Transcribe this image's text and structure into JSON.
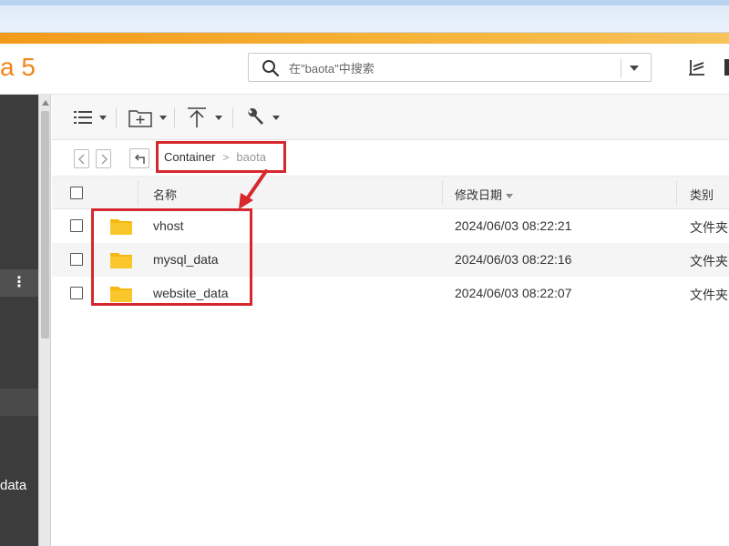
{
  "app": {
    "logo_text": "a 5"
  },
  "colors": {
    "accent_orange": "#f0861b",
    "annotation_red": "#d7272e",
    "folder_yellow": "#f6b70f"
  },
  "search": {
    "placeholder": "在\"baota\"中搜索",
    "value": ""
  },
  "header_icons": [
    "stack-icon",
    "window-icon"
  ],
  "sidebar": {
    "visible_label": "data",
    "menu_icon": "⋮"
  },
  "toolbar": {
    "buttons": [
      {
        "icon": "list-view-icon"
      },
      {
        "icon": "new-folder-icon"
      },
      {
        "icon": "upload-icon"
      },
      {
        "icon": "wrench-icon"
      }
    ]
  },
  "navigation": {
    "breadcrumb": [
      "Container",
      "baota"
    ],
    "separator": ">"
  },
  "table": {
    "columns": {
      "name": "名称",
      "modified": "修改日期",
      "type": "类别"
    },
    "rows": [
      {
        "name": "vhost",
        "modified": "2024/06/03 08:22:21",
        "type": "文件夹"
      },
      {
        "name": "mysql_data",
        "modified": "2024/06/03 08:22:16",
        "type": "文件夹"
      },
      {
        "name": "website_data",
        "modified": "2024/06/03 08:22:07",
        "type": "文件夹"
      }
    ]
  }
}
